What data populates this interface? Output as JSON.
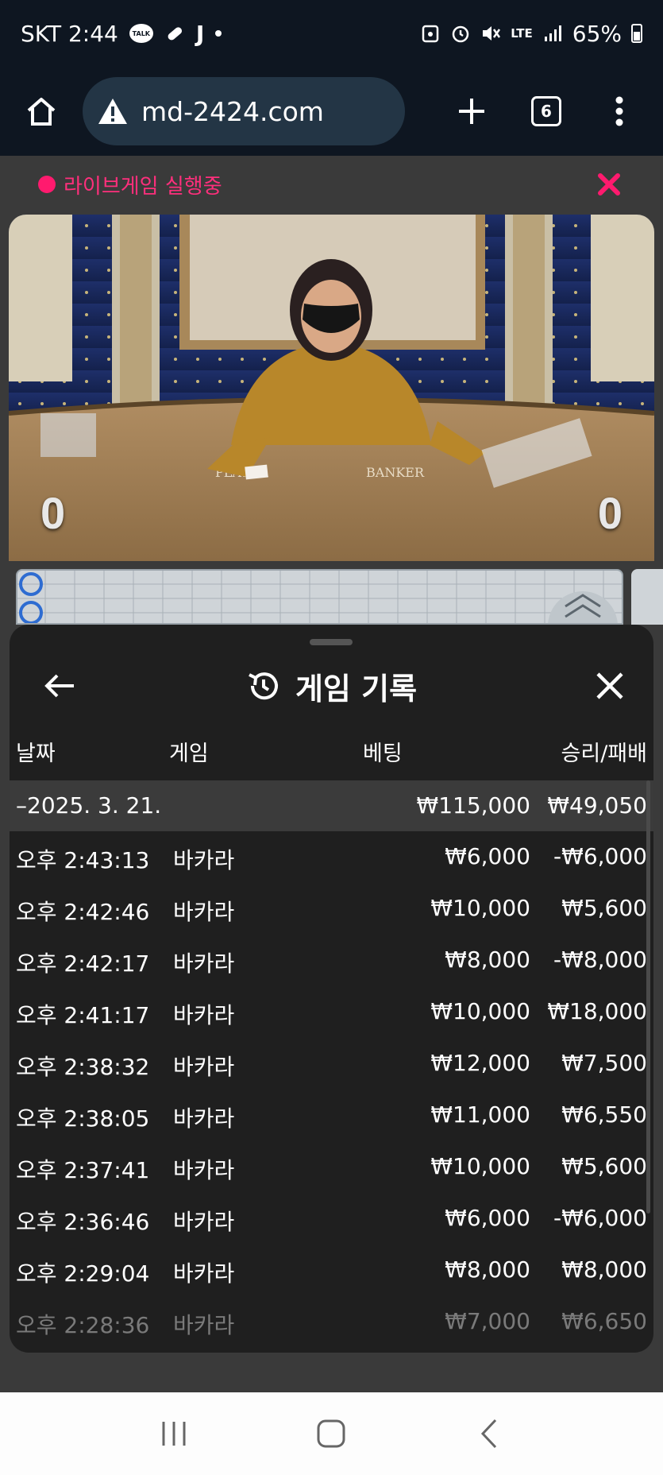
{
  "status_bar": {
    "carrier_time": "SKT 2:44",
    "talk_label": "TALK",
    "letter": "J",
    "network": "LTE",
    "battery": "65%"
  },
  "browser": {
    "url": "md-2424.com",
    "tab_count": "6"
  },
  "live": {
    "label": "라이브게임 실행중",
    "accent": "#ff1a6e",
    "player_score": "0",
    "banker_score": "0"
  },
  "history": {
    "title": "게임 기록",
    "columns": {
      "date": "날짜",
      "game": "게임",
      "bet": "베팅",
      "result": "승리/패배"
    },
    "group": {
      "date": "–2025. 3. 21.",
      "bet": "₩115,000",
      "result": "₩49,050"
    },
    "rows": [
      {
        "time": "오후 2:43:13",
        "game": "바카라",
        "bet": "₩6,000",
        "result": "-₩6,000"
      },
      {
        "time": "오후 2:42:46",
        "game": "바카라",
        "bet": "₩10,000",
        "result": "₩5,600"
      },
      {
        "time": "오후 2:42:17",
        "game": "바카라",
        "bet": "₩8,000",
        "result": "-₩8,000"
      },
      {
        "time": "오후 2:41:17",
        "game": "바카라",
        "bet": "₩10,000",
        "result": "₩18,000"
      },
      {
        "time": "오후 2:38:32",
        "game": "바카라",
        "bet": "₩12,000",
        "result": "₩7,500"
      },
      {
        "time": "오후 2:38:05",
        "game": "바카라",
        "bet": "₩11,000",
        "result": "₩6,550"
      },
      {
        "time": "오후 2:37:41",
        "game": "바카라",
        "bet": "₩10,000",
        "result": "₩5,600"
      },
      {
        "time": "오후 2:36:46",
        "game": "바카라",
        "bet": "₩6,000",
        "result": "-₩6,000"
      },
      {
        "time": "오후 2:29:04",
        "game": "바카라",
        "bet": "₩8,000",
        "result": "₩8,000"
      },
      {
        "time": "오후 2:28:36",
        "game": "바카라",
        "bet": "₩7,000",
        "result": "₩6,650"
      }
    ]
  }
}
